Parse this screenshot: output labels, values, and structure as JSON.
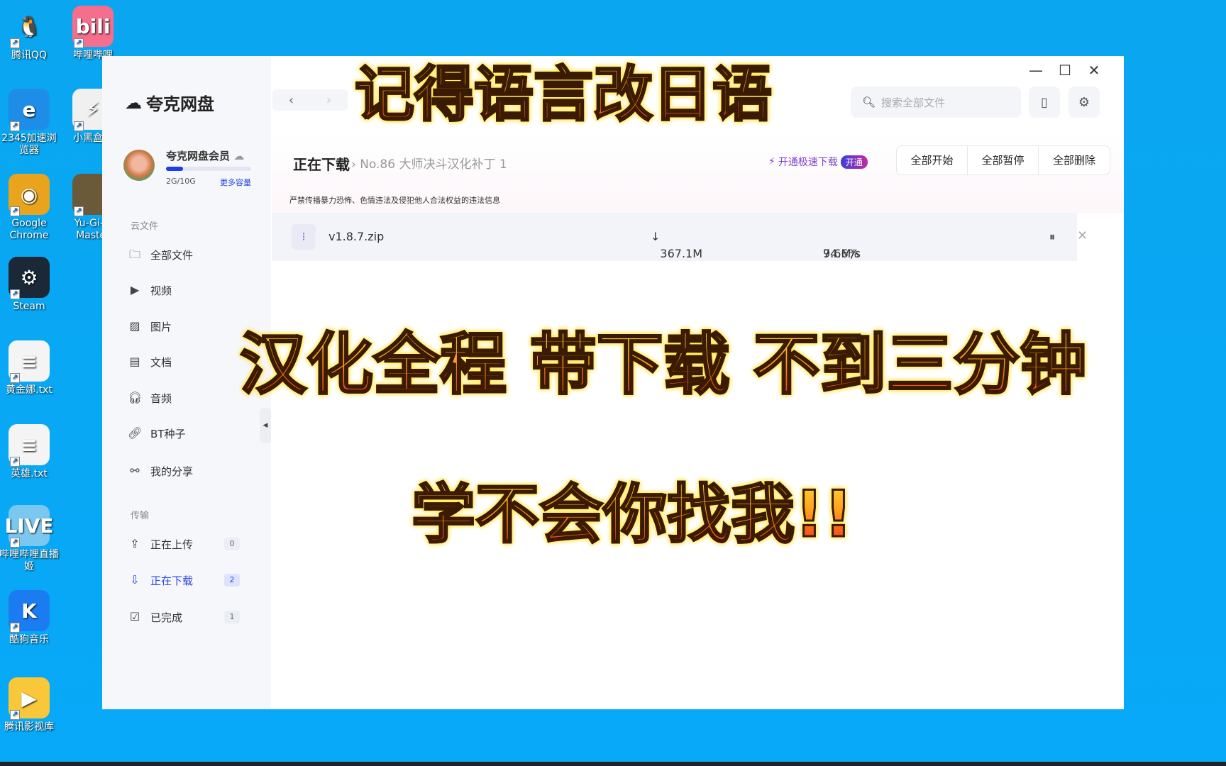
{
  "desktop": {
    "icons": [
      {
        "label": "腾讯QQ",
        "glyph": "🐧",
        "color": "#0aa6f0"
      },
      {
        "label": "哔哩哔哩",
        "glyph": "bili",
        "color": "#f56e8c"
      },
      {
        "label": "2345加速浏览器",
        "glyph": "e",
        "color": "#1e8de8"
      },
      {
        "label": "小黑盒加",
        "glyph": "⚡",
        "color": "#f0f0f0"
      },
      {
        "label": "Google Chrome",
        "glyph": "◉",
        "color": "#e8a41c"
      },
      {
        "label": "Yu-Gi-O Master",
        "glyph": "",
        "color": "#6a5a3a"
      },
      {
        "label": "Steam",
        "glyph": "⚙",
        "color": "#1b2838"
      },
      {
        "label": "黄金娜.txt",
        "glyph": "≡",
        "color": "#f4f4f4"
      },
      {
        "label": "英雄.txt",
        "glyph": "≡",
        "color": "#f4f4f4"
      },
      {
        "label": "哔哩哔哩直播姬",
        "glyph": "LIVE",
        "color": "#7ac8f0"
      },
      {
        "label": "酷狗音乐",
        "glyph": "K",
        "color": "#1a7cf0"
      },
      {
        "label": "腾讯影视库",
        "glyph": "▶",
        "color": "#f8c83a"
      }
    ]
  },
  "app": {
    "name": "夸克网盘",
    "search_placeholder": "搜索全部文件",
    "user": {
      "name": "夸克网盘会员",
      "storage": "2G/10G",
      "storage_fraction": 0.2,
      "more": "更多容量"
    },
    "sections": {
      "cloud": "云文件",
      "transfer": "传输"
    },
    "cloud_items": [
      {
        "label": "全部文件",
        "icon": "folder-icon"
      },
      {
        "label": "视频",
        "icon": "video-icon"
      },
      {
        "label": "图片",
        "icon": "image-icon"
      },
      {
        "label": "文档",
        "icon": "document-icon"
      },
      {
        "label": "音频",
        "icon": "headphones-icon"
      },
      {
        "label": "BT种子",
        "icon": "link-icon"
      },
      {
        "label": "我的分享",
        "icon": "share-icon"
      }
    ],
    "transfer_items": [
      {
        "label": "正在上传",
        "count": "0"
      },
      {
        "label": "正在下载",
        "count": "2",
        "active": true
      },
      {
        "label": "已完成",
        "count": "1"
      }
    ],
    "main": {
      "title": "正在下载",
      "crumb": "No.86 大师决斗汉化补丁 1",
      "vip_text": "开通极速下载",
      "vip_badge": "开通",
      "buttons": [
        "全部开始",
        "全部暂停",
        "全部删除"
      ],
      "notice": "严禁传播暴力恐怖、色情违法及侵犯他人合法权益的违法信息",
      "downloads": [
        {
          "name": "v1.8.7.zip",
          "size": "367.1M",
          "progress": "94.6%",
          "speed": "7.6M/s"
        }
      ]
    },
    "accent": "#2a46e8"
  },
  "overlay": {
    "line1": "记得语言改日语",
    "line2": "汉化全程 带下载 不到三分钟",
    "line3": "学不会你找我!!"
  }
}
